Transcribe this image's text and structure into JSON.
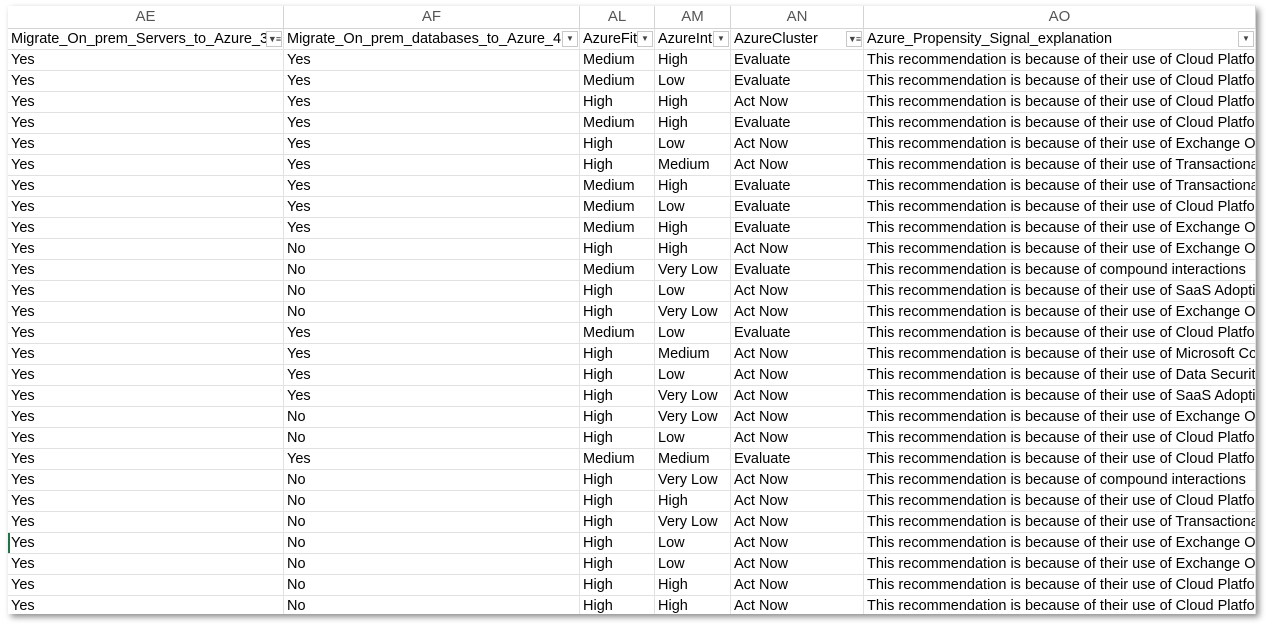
{
  "columns": [
    {
      "letter": "AE",
      "header": "Migrate_On_prem_Servers_to_Azure_3",
      "filter_active": true
    },
    {
      "letter": "AF",
      "header": "Migrate_On_prem_databases_to_Azure_4",
      "filter_active": false
    },
    {
      "letter": "AL",
      "header": "AzureFit",
      "filter_active": false
    },
    {
      "letter": "AM",
      "header": "AzureInt",
      "filter_active": false
    },
    {
      "letter": "AN",
      "header": "AzureCluster",
      "filter_active": true
    },
    {
      "letter": "AO",
      "header": "Azure_Propensity_Signal_explanation",
      "filter_active": false
    }
  ],
  "filter_icons": {
    "inactive": "dropdown-arrow-icon",
    "active": "filter-funnel-icon"
  },
  "rows": [
    [
      "Yes",
      "Yes",
      "Medium",
      "High",
      "Evaluate",
      "This recommendation is because of their use of Cloud Platfo"
    ],
    [
      "Yes",
      "Yes",
      "Medium",
      "Low",
      "Evaluate",
      "This recommendation is because of their use of Cloud Platfo"
    ],
    [
      "Yes",
      "Yes",
      "High",
      "High",
      "Act Now",
      "This recommendation is because of their use of Cloud Platfo"
    ],
    [
      "Yes",
      "Yes",
      "Medium",
      "High",
      "Evaluate",
      "This recommendation is because of their use of Cloud Platfo"
    ],
    [
      "Yes",
      "Yes",
      "High",
      "Low",
      "Act Now",
      "This recommendation is because of their use of Exchange On"
    ],
    [
      "Yes",
      "Yes",
      "High",
      "Medium",
      "Act Now",
      "This recommendation is because of their use of Transactiona"
    ],
    [
      "Yes",
      "Yes",
      "Medium",
      "High",
      "Evaluate",
      "This recommendation is because of their use of Transactiona"
    ],
    [
      "Yes",
      "Yes",
      "Medium",
      "Low",
      "Evaluate",
      "This recommendation is because of their use of Cloud Platfo"
    ],
    [
      "Yes",
      "Yes",
      "Medium",
      "High",
      "Evaluate",
      "This recommendation is because of their use of Exchange On"
    ],
    [
      "Yes",
      "No",
      "High",
      "High",
      "Act Now",
      "This recommendation is because of their use of Exchange On"
    ],
    [
      "Yes",
      "No",
      "Medium",
      "Very Low",
      "Evaluate",
      "This recommendation is because of compound interactions"
    ],
    [
      "Yes",
      "No",
      "High",
      "Low",
      "Act Now",
      "This recommendation is because of their use of SaaS Adoptic"
    ],
    [
      "Yes",
      "No",
      "High",
      "Very Low",
      "Act Now",
      "This recommendation is because of their use of Exchange On"
    ],
    [
      "Yes",
      "Yes",
      "Medium",
      "Low",
      "Evaluate",
      "This recommendation is because of their use of Cloud Platfo"
    ],
    [
      "Yes",
      "Yes",
      "High",
      "Medium",
      "Act Now",
      "This recommendation is because of their use of Microsoft Co"
    ],
    [
      "Yes",
      "Yes",
      "High",
      "Low",
      "Act Now",
      "This recommendation is because of their use of Data Securit"
    ],
    [
      "Yes",
      "Yes",
      "High",
      "Very Low",
      "Act Now",
      "This recommendation is because of their use of SaaS Adoptic"
    ],
    [
      "Yes",
      "No",
      "High",
      "Very Low",
      "Act Now",
      "This recommendation is because of their use of Exchange On"
    ],
    [
      "Yes",
      "No",
      "High",
      "Low",
      "Act Now",
      "This recommendation is because of their use of Cloud Platfo"
    ],
    [
      "Yes",
      "Yes",
      "Medium",
      "Medium",
      "Evaluate",
      "This recommendation is because of their use of Cloud Platfo"
    ],
    [
      "Yes",
      "No",
      "High",
      "Very Low",
      "Act Now",
      "This recommendation is because of compound interactions"
    ],
    [
      "Yes",
      "No",
      "High",
      "High",
      "Act Now",
      "This recommendation is because of their use of Cloud Platfo"
    ],
    [
      "Yes",
      "No",
      "High",
      "Very Low",
      "Act Now",
      "This recommendation is because of their use of Transactiona"
    ],
    [
      "Yes",
      "No",
      "High",
      "Low",
      "Act Now",
      "This recommendation is because of their use of Exchange On"
    ],
    [
      "Yes",
      "No",
      "High",
      "Low",
      "Act Now",
      "This recommendation is because of their use of Exchange On"
    ],
    [
      "Yes",
      "No",
      "High",
      "High",
      "Act Now",
      "This recommendation is because of their use of Cloud Platfo"
    ],
    [
      "Yes",
      "No",
      "High",
      "High",
      "Act Now",
      "This recommendation is because of their use of Cloud Platfo"
    ]
  ],
  "selection_mark_row": 23,
  "colors": {
    "gridline": "#e1e1e1",
    "header_text": "#555555",
    "selection": "#217346"
  }
}
